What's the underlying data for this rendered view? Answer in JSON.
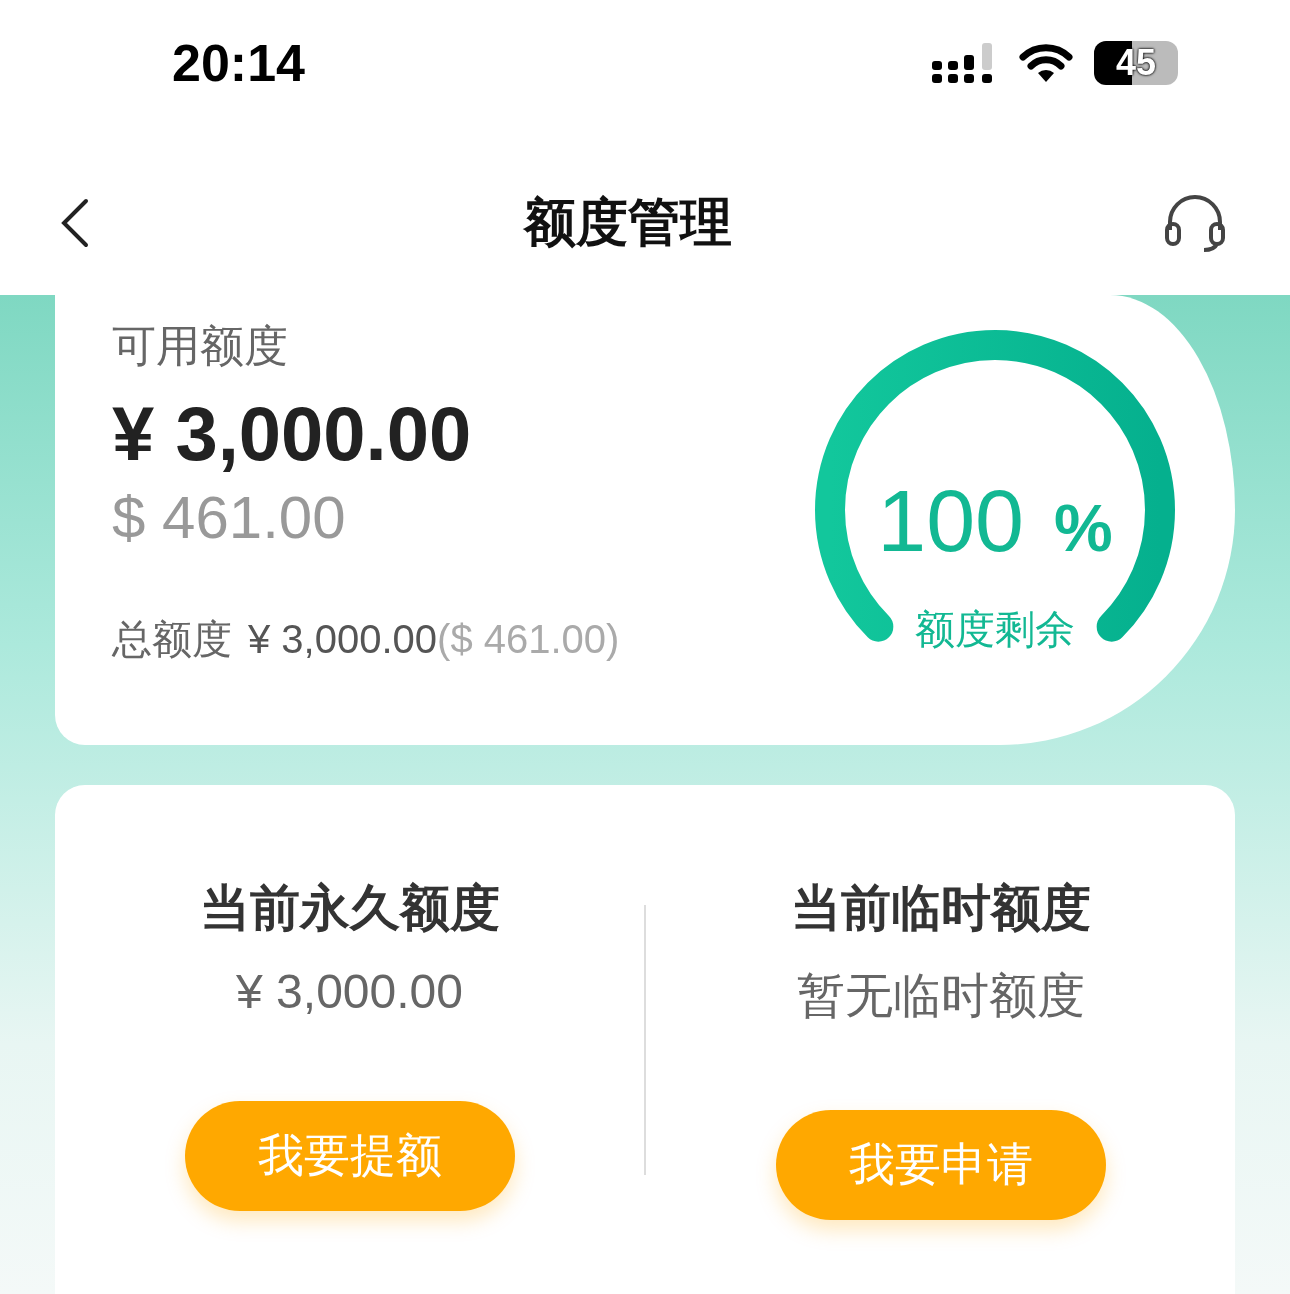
{
  "status_bar": {
    "time": "20:14",
    "battery": "45"
  },
  "nav": {
    "title": "额度管理"
  },
  "available": {
    "label": "可用额度",
    "amount": "¥ 3,000.00",
    "amount_usd": "$ 461.00",
    "total_label": "总额度",
    "total": "¥ 3,000.00",
    "total_usd": "($ 461.00)"
  },
  "gauge": {
    "value": "100",
    "unit": "%",
    "caption": "额度剩余"
  },
  "limits": [
    {
      "title": "当前永久额度",
      "value": "¥ 3,000.00",
      "button": "我要提额"
    },
    {
      "title": "当前临时额度",
      "value": "暂无临时额度",
      "button": "我要申请"
    }
  ]
}
